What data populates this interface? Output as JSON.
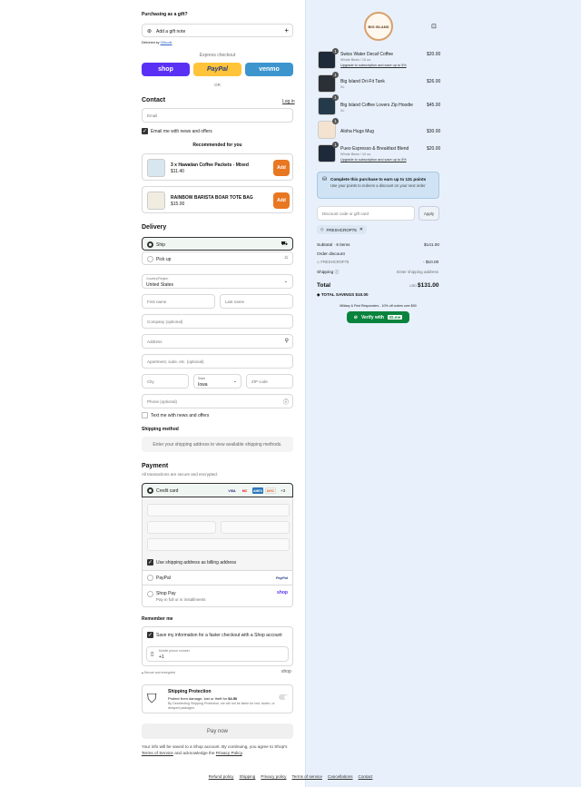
{
  "gift": {
    "title": "Purchasing as a gift?",
    "note": "Add a gift note",
    "delivered_by": "Delivered by",
    "delivered_by_link": "Giftcode"
  },
  "express": {
    "title": "Express checkout",
    "shop": "shop",
    "paypal": "PayPal",
    "venmo": "venmo",
    "or": "OR"
  },
  "contact": {
    "title": "Contact",
    "login": "Log in",
    "email_placeholder": "Email",
    "news": "Email me with news and offers"
  },
  "recommended": {
    "title": "Recommended for you",
    "items": [
      {
        "name": "3 x Hawaiian Coffee Packets - Mixed",
        "price": "$11.40",
        "add": "Add"
      },
      {
        "name": "RAINBOW BARISTA BOAR TOTE BAG",
        "price": "$15.00",
        "add": "Add"
      }
    ]
  },
  "delivery": {
    "title": "Delivery",
    "ship": "Ship",
    "pickup": "Pick up",
    "country_label": "Country/Region",
    "country": "United States",
    "first": "First name",
    "last": "Last name",
    "company": "Company (optional)",
    "address": "Address",
    "apt": "Apartment, suite, etc. (optional)",
    "city": "City",
    "state_label": "State",
    "state": "Iowa",
    "zip": "ZIP code",
    "phone": "Phone (optional)",
    "text_news": "Text me with news and offers"
  },
  "shipping_method": {
    "title": "Shipping method",
    "note": "Enter your shipping address to view available shipping methods."
  },
  "payment": {
    "title": "Payment",
    "subtitle": "All transactions are secure and encrypted.",
    "credit": "Credit card",
    "more": "+3",
    "billing": "Use shipping address as billing address",
    "paypal": "PayPal",
    "shoppay": "Shop Pay",
    "shoppay_sub": "Pay in full or in installments",
    "card_logos": [
      "VISA",
      "MC",
      "AMEX",
      "DISC"
    ]
  },
  "remember": {
    "title": "Remember me",
    "save": "Save my information for a faster checkout with a Shop account",
    "mobile_label": "Mobile phone number",
    "mobile_val": "+1",
    "secure": "Secure and encrypted",
    "shop": "shop"
  },
  "protection": {
    "title": "Shipping Protection",
    "line1": "Protect from damage, lost or theft for",
    "price": "$4.50",
    "line2": "By Deselecting Shipping Protection, we will not be liable for lost, stolen, or delayed packages."
  },
  "pay_now": "Pay now",
  "consent": {
    "pre": "Your info will be saved to a Shop account. By continuing, you agree to Shop's",
    "tos": "Terms of Service",
    "mid": "and acknowledge the",
    "privacy": "Privacy Policy",
    "end": "."
  },
  "footer": [
    "Refund policy",
    "Shipping",
    "Privacy policy",
    "Terms of service",
    "Cancellations",
    "Contact"
  ],
  "logo_text": "BIG ISLAND",
  "cart": {
    "items": [
      {
        "qty": "1",
        "name": "Swiss Water Decaf Coffee",
        "variant": "Whole Bean / 10 oz.",
        "upgrade": "Upgrade to subscription and save up to 5%",
        "price": "$20.00"
      },
      {
        "qty": "1",
        "name": "Big Island Dri-Fit Tank",
        "variant": "XL",
        "upgrade": "",
        "price": "$26.00"
      },
      {
        "qty": "1",
        "name": "Big Island Coffee Lovers Zip Hoodie",
        "variant": "XL",
        "upgrade": "",
        "price": "$45.00"
      },
      {
        "qty": "1",
        "name": "Aloha Hugs Mug",
        "variant": "",
        "upgrade": "",
        "price": "$30.00"
      },
      {
        "qty": "1",
        "name": "Pueo Espresso & Breakfast Blend",
        "variant": "Whole Bean / 10 oz.",
        "upgrade": "Upgrade to subscription and save up to 5%",
        "price": "$20.00"
      }
    ],
    "points_title": "Complete this purchase to earn up to 131 points",
    "points_sub": "Use your points to redeem a discount on your next order",
    "discount_placeholder": "Discount code or gift card",
    "apply": "Apply",
    "code": "FRESHCROP75",
    "subtotal_label": "Subtotal · 5 items",
    "subtotal": "$141.00",
    "order_discount": "Order discount",
    "discount_code": "FRESHCROP75",
    "discount_amt": "- $10.00",
    "shipping_label": "Shipping",
    "shipping_val": "Enter shipping address",
    "total_label": "Total",
    "currency": "USD",
    "total": "$131.00",
    "savings": "TOTAL SAVINGS $10.00",
    "military": "Military & First Responders - 10% off orders over $90",
    "verify": "Verify with",
    "idme": "ID.me"
  },
  "colors": {
    "shop": "#5a31f4",
    "paypal": "#ffc439",
    "venmo": "#3d95ce",
    "add": "#e87722",
    "idme": "#08833d",
    "page_right": "#e8f1fb"
  }
}
